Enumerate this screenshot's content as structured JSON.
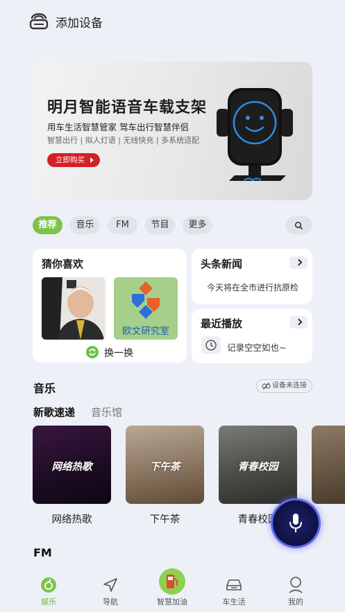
{
  "header": {
    "add_device": "添加设备"
  },
  "banner": {
    "title": "明月智能语音车载支架",
    "subtitle": "用车生活智慧管家  驾车出行智慧伴侣",
    "features": "智慧出行 | 拟人灯语 | 无线快充 | 多系统适配",
    "buy_button": "立即购买"
  },
  "chips": [
    "推荐",
    "音乐",
    "FM",
    "节目",
    "更多"
  ],
  "guess": {
    "title": "猜你喜欢",
    "album_text": "欧文研究室",
    "refresh_label": "换一换"
  },
  "headlines": {
    "title": "头条新闻",
    "text": "今天将在全市进行抗原检"
  },
  "recent": {
    "title": "最近播放",
    "text": "记录空空如也~"
  },
  "music": {
    "title": "音乐",
    "device_status": "设备未连接",
    "tabs": [
      "新歌速递",
      "音乐馆"
    ],
    "tiles": [
      {
        "art_text": "网络热歌",
        "label": "网络热歌"
      },
      {
        "art_text": "下午茶",
        "label": "下午茶"
      },
      {
        "art_text": "青春校园",
        "label": "青春校园"
      }
    ]
  },
  "fm": {
    "title": "FM"
  },
  "nav": {
    "items": [
      {
        "label": "娱乐",
        "active": true
      },
      {
        "label": "导航",
        "active": false
      },
      {
        "label": "智慧加油",
        "active": false
      },
      {
        "label": "车生活",
        "active": false
      },
      {
        "label": "我的",
        "active": false
      }
    ]
  },
  "colors": {
    "accent": "#7cc34a",
    "buy": "#d32027",
    "mic_ring": "#5a6df0"
  }
}
